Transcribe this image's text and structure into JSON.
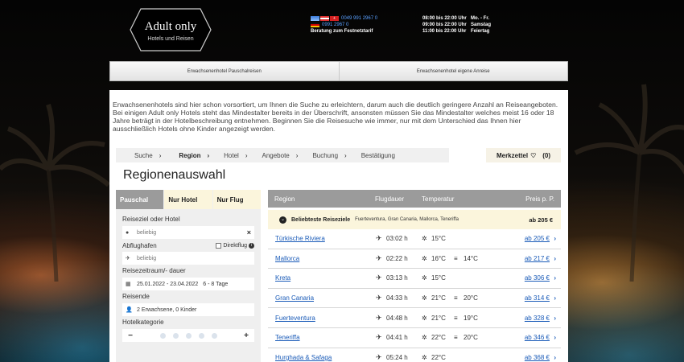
{
  "header": {
    "logo_title": "Adult only",
    "logo_subtitle": "Hotels und Reisen",
    "phones": [
      {
        "flags": [
          "#3b7bd9",
          "#d42020"
        ],
        "number": "0049 991 2967 0"
      },
      {
        "flags": [
          "#1a1a1a"
        ],
        "number": "0991 2967 0"
      }
    ],
    "consult_note": "Beratung zum Festnetztarif",
    "hours": [
      {
        "time": "08:00 bis 22:00 Uhr",
        "day": "Mo. - Fr."
      },
      {
        "time": "09:00 bis 22:00 Uhr",
        "day": "Samstag"
      },
      {
        "time": "11:00 bis 22:00 Uhr",
        "day": "Feiertag"
      }
    ]
  },
  "topnav": {
    "items": [
      "Erwachsenenhotel Pauschalreisen",
      "Erwachsenenhotel eigene Anreise"
    ]
  },
  "intro_text": "Erwachsenenhotels sind hier schon vorsortiert, um Ihnen die Suche zu erleichtern, darum auch die deutlich geringere Anzahl an Reiseangeboten. Bei einigen Adult only Hotels steht das Mindestalter bereits in der Überschrift, ansonsten müssen Sie das Mindestalter welches meist 16 oder 18 Jahre beträgt in der Hotelbeschreibung entnehmen. Beginnen Sie die Reisesuche wie immer, nur mit dem Unterschied das Ihnen hier ausschließlich Hotels ohne Kinder angezeigt werden.",
  "steps": [
    "Suche",
    "Region",
    "Hotel",
    "Angebote",
    "Buchung",
    "Bestätigung"
  ],
  "merkzettel": {
    "label": "Merkzettel",
    "count": "(0)"
  },
  "page_title": "Regionenauswahl",
  "search": {
    "tabs": [
      "Pauschal",
      "Nur Hotel",
      "Nur Flug"
    ],
    "destination_label": "Reiseziel oder Hotel",
    "destination_placeholder": "beliebig",
    "departure_label": "Abflughafen",
    "direct_flight_label": "Direktflug",
    "departure_placeholder": "beliebig",
    "period_label": "Reisezeitraum/- dauer",
    "period_value": "25.01.2022 - 23.04.2022",
    "duration_value": "6 - 8 Tage",
    "travelers_label": "Reisende",
    "travelers_value": "2 Erwachsene, 0 Kinder",
    "category_label": "Hotelkategorie",
    "category_stars": 0
  },
  "table": {
    "headers": {
      "region": "Region",
      "flight": "Flugdauer",
      "temp": "Temperatur",
      "price": "Preis p. P."
    },
    "popular": {
      "title": "Beliebteste Reiseziele",
      "list": "Fuerteventura, Gran Canaria, Mallorca, Teneriffa",
      "price": "ab 205 €"
    },
    "rows": [
      {
        "region": "Türkische Riviera",
        "flight": "03:02 h",
        "air": "15°C",
        "water": "",
        "price": "ab 205 €"
      },
      {
        "region": "Mallorca",
        "flight": "02:22 h",
        "air": "16°C",
        "water": "14°C",
        "price": "ab 217 €"
      },
      {
        "region": "Kreta",
        "flight": "03:13 h",
        "air": "15°C",
        "water": "",
        "price": "ab 306 €"
      },
      {
        "region": "Gran Canaria",
        "flight": "04:33 h",
        "air": "21°C",
        "water": "20°C",
        "price": "ab 314 €"
      },
      {
        "region": "Fuerteventura",
        "flight": "04:48 h",
        "air": "21°C",
        "water": "19°C",
        "price": "ab 328 €"
      },
      {
        "region": "Teneriffa",
        "flight": "04:41 h",
        "air": "22°C",
        "water": "20°C",
        "price": "ab 346 €"
      },
      {
        "region": "Hurghada & Safaga",
        "flight": "05:24 h",
        "air": "22°C",
        "water": "",
        "price": "ab 368 €"
      }
    ]
  }
}
